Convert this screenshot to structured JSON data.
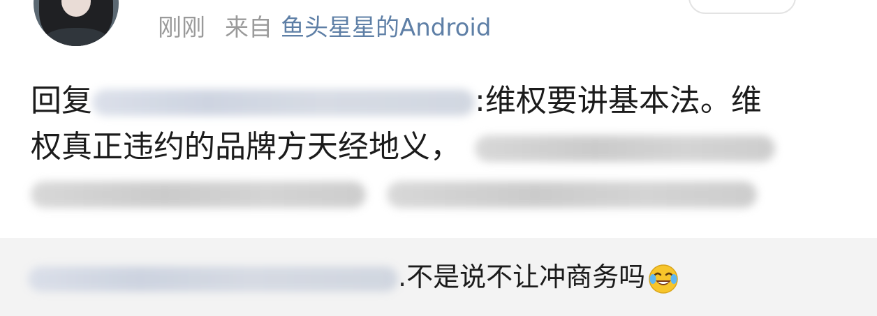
{
  "post": {
    "time": "刚刚",
    "from_label": "来自",
    "source": "鱼头星星的Android"
  },
  "reply": {
    "prefix": "回复",
    "line1_after": ":维权要讲基本法。维",
    "line2": "权真正违约的品牌方天经地义，"
  },
  "quoted": {
    "after": ".不是说不让冲商务吗"
  },
  "icons": {
    "avatar": "user-avatar",
    "emoji": "laugh-cry-emoji"
  },
  "colors": {
    "source_link": "#5e7fa6",
    "meta_text": "#9a9a9a",
    "quote_bg": "#f3f3f3"
  }
}
